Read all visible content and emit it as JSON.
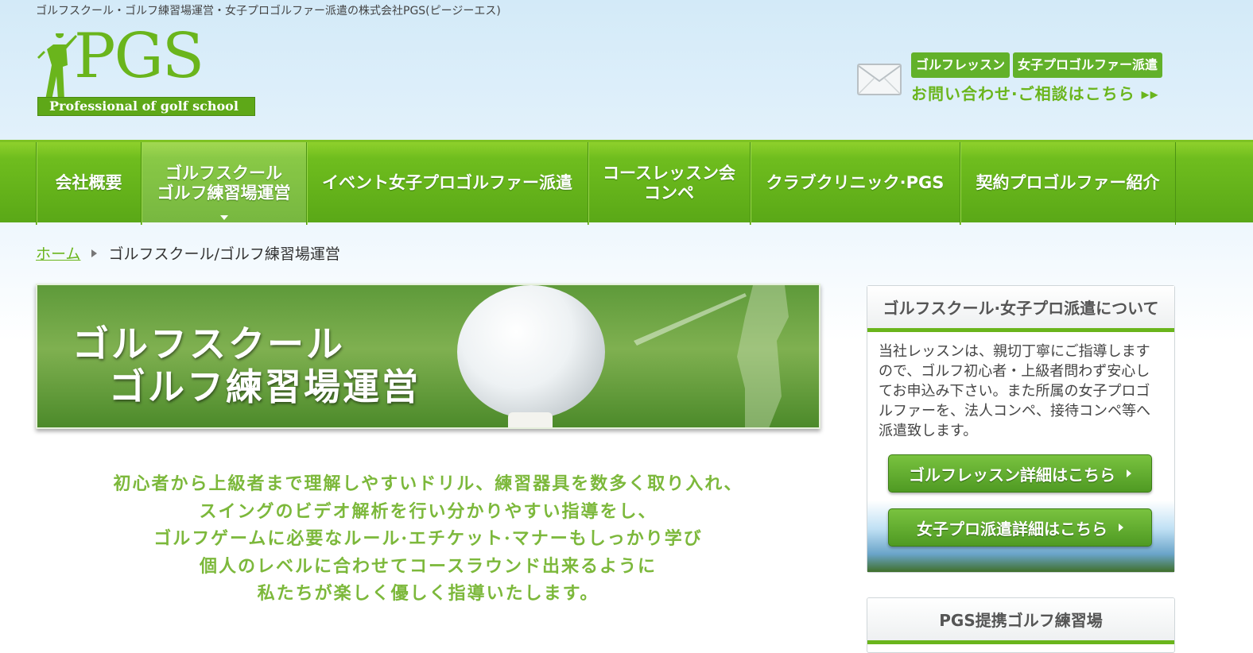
{
  "header": {
    "tagline": "ゴルフスクール・ゴルフ練習場運営・女子プロゴルファー派遣の株式会社PGS(ピージーエス)",
    "logo_text": "PGS",
    "logo_sub": "Professional of golf school",
    "contact_tags": [
      "ゴルフレッスン",
      "女子プロゴルファー派遣"
    ],
    "contact_link": "お問い合わせ·ご相談はこちら ▸▸"
  },
  "nav": {
    "items": [
      {
        "label": "会社概要"
      },
      {
        "label": "ゴルフスクール",
        "label2": "ゴルフ練習場運営"
      },
      {
        "label": "イベント女子プロゴルファー派遣"
      },
      {
        "label": "コースレッスン会",
        "label2": "コンペ"
      },
      {
        "label": "クラブクリニック·PGS"
      },
      {
        "label": "契約プロゴルファー紹介"
      }
    ]
  },
  "breadcrumb": {
    "home": "ホーム",
    "current": "ゴルフスクール/ゴルフ練習場運営"
  },
  "hero": {
    "title_line1": "ゴルフスクール",
    "title_line2": "ゴルフ練習場運営"
  },
  "intro": {
    "lines": [
      "初心者から上級者まで理解しやすいドリル、練習器具を数多く取り入れ、",
      "スイングのビデオ解析を行い分かりやすい指導をし、",
      "ゴルフゲームに必要なルール·エチケット·マナーもしっかり学び",
      "個人のレベルに合わせてコースラウンド出来るように",
      "私たちが楽しく優しく指導いたします。"
    ]
  },
  "sidebar": {
    "box1_title": "ゴルフスクール·女子プロ派遣について",
    "box1_text": "当社レッスンは、親切丁寧にご指導しますので、ゴルフ初心者・上級者問わず安心してお申込み下さい。また所属の女子プロゴルファーを、法人コンペ、接待コンペ等へ派遣致します。",
    "btn_lesson": "ゴルフレッスン詳細はこちら",
    "btn_dispatch": "女子プロ派遣詳細はこちら",
    "box2_title": "PGS提携ゴルフ練習場"
  },
  "colors": {
    "brand_green": "#6ab51c",
    "nav_green": "#5aa817",
    "intro_green": "#7cb83b"
  }
}
